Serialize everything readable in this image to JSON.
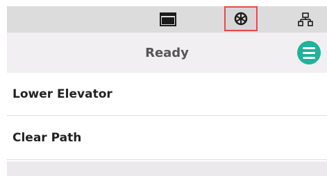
{
  "toolbar": {
    "icons": [
      "monitor-icon",
      "wheel-icon",
      "network-icon"
    ],
    "highlight_color": "#e5484d"
  },
  "status": {
    "text": "Ready",
    "menu_button_color": "#1fb39a"
  },
  "actions": [
    {
      "label": "Lower Elevator"
    },
    {
      "label": "Clear Path"
    }
  ]
}
